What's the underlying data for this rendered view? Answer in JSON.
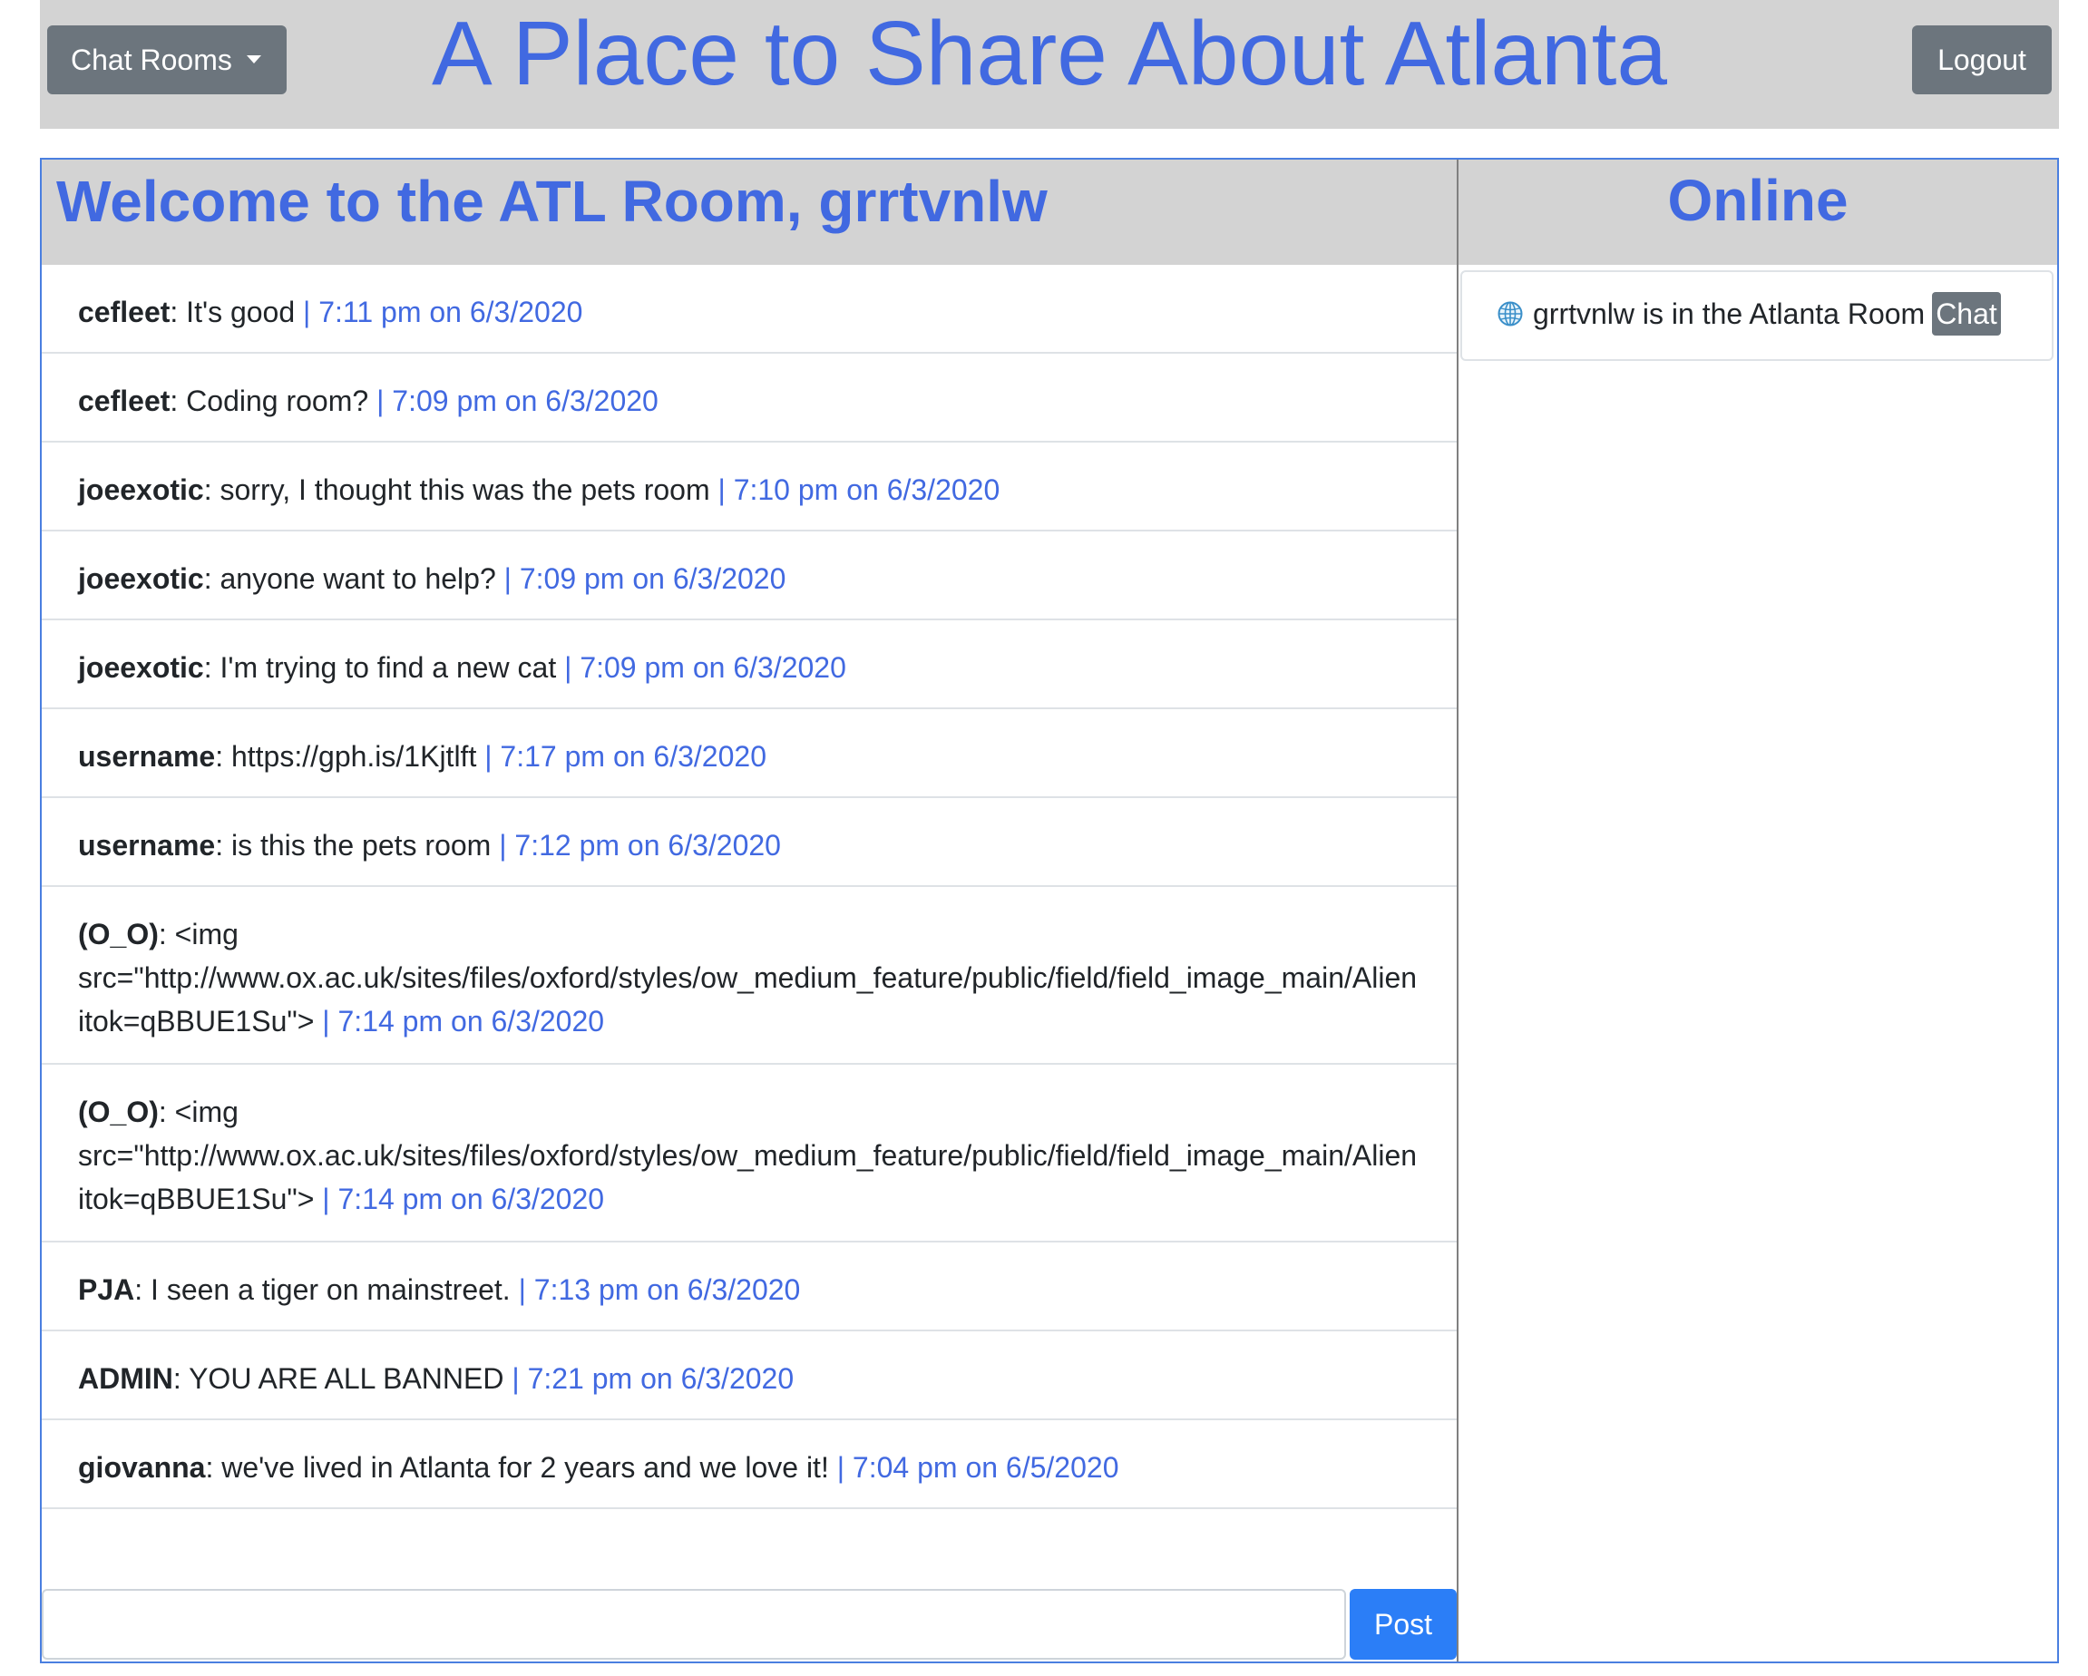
{
  "header": {
    "rooms_button": "Chat Rooms",
    "title": "A Place to Share About Atlanta",
    "logout_button": "Logout"
  },
  "room": {
    "heading": "Welcome to the ATL Room, grrtvnlw",
    "messages": [
      {
        "user": "cefleet",
        "text": ": It's good ",
        "time": "| 7:11 pm on 6/3/2020"
      },
      {
        "user": "cefleet",
        "text": ": Coding room? ",
        "time": "| 7:09 pm on 6/3/2020"
      },
      {
        "user": "joeexotic",
        "text": ": sorry, I thought this was the pets room ",
        "time": "| 7:10 pm on 6/3/2020"
      },
      {
        "user": "joeexotic",
        "text": ": anyone want to help? ",
        "time": "| 7:09 pm on 6/3/2020"
      },
      {
        "user": "joeexotic",
        "text": ": I'm trying to find a new cat ",
        "time": "| 7:09 pm on 6/3/2020"
      },
      {
        "user": "username",
        "text": ": https://gph.is/1Kjtlft ",
        "time": "| 7:17 pm on 6/3/2020"
      },
      {
        "user": "username",
        "text": ": is this the pets room ",
        "time": "| 7:12 pm on 6/3/2020"
      },
      {
        "user": "(O_O)",
        "text": ": <img",
        "line2": "src=\"http://www.ox.ac.uk/sites/files/oxford/styles/ow_medium_feature/public/field/field_image_main/Alien",
        "line3": "itok=qBBUE1Su\"> ",
        "time": "| 7:14 pm on 6/3/2020"
      },
      {
        "user": "(O_O)",
        "text": ": <img",
        "line2": "src=\"http://www.ox.ac.uk/sites/files/oxford/styles/ow_medium_feature/public/field/field_image_main/Alien",
        "line3": "itok=qBBUE1Su\"> ",
        "time": "| 7:14 pm on 6/3/2020"
      },
      {
        "user": "PJA",
        "text": ": I seen a tiger on mainstreet. ",
        "time": "| 7:13 pm on 6/3/2020"
      },
      {
        "user": "ADMIN",
        "text": ": YOU ARE ALL BANNED ",
        "time": "| 7:21 pm on 6/3/2020"
      },
      {
        "user": "giovanna",
        "text": ": we've lived in Atlanta for 2 years and we love it! ",
        "time": "| 7:04 pm on 6/5/2020"
      }
    ],
    "compose": {
      "value": "",
      "placeholder": "",
      "post_button": "Post"
    }
  },
  "online": {
    "heading": "Online",
    "users": [
      {
        "icon": "globe-icon",
        "text": "grrtvnlw is in the Atlanta Room",
        "chat_button": "Chat"
      }
    ]
  },
  "colors": {
    "accent": "#4169e1",
    "header_bg": "#d3d3d3",
    "button_gray": "#6c757d",
    "post_blue": "#2b7ef7",
    "frame_border": "#4a7fe0"
  }
}
